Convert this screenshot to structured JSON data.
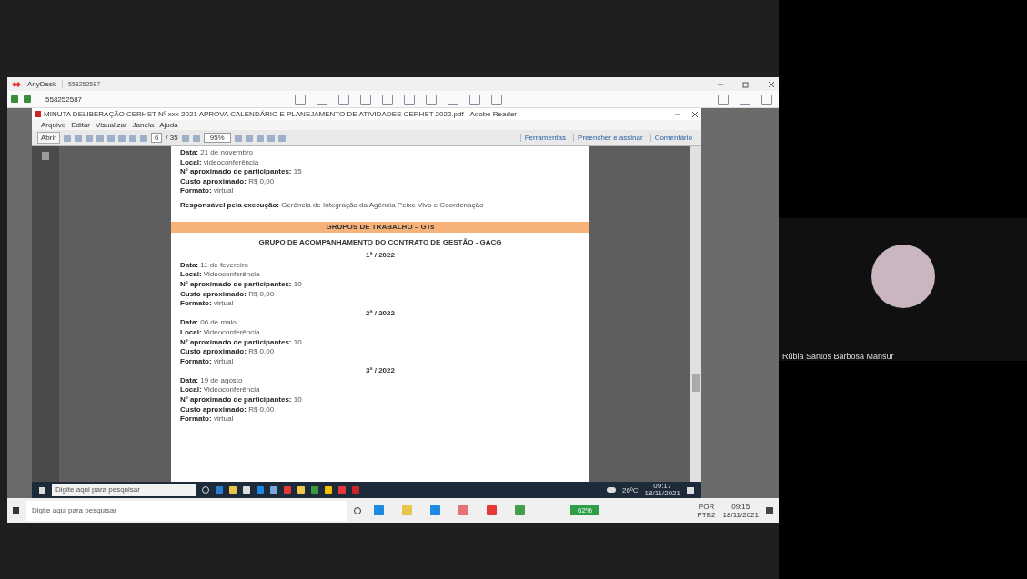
{
  "anydesk": {
    "app_name": "AnyDesk",
    "tab_label": "558252587",
    "address": "558252587"
  },
  "reader": {
    "title": "MINUTA DELIBERAÇÃO CERHST Nº xxx 2021 APROVA CALENDÁRIO E PLANEJAMENTO DE ATIVIDADES CERHST 2022.pdf - Adobe Reader",
    "menu": [
      "Arquivo",
      "Editar",
      "Visualizar",
      "Janela",
      "Ajuda"
    ],
    "open_button": "Abrir",
    "page_number": "6",
    "page_total": "/ 35",
    "zoom": "95%",
    "panel_buttons": [
      "Ferramentas",
      "Preencher e assinar",
      "Comentário"
    ]
  },
  "document": {
    "top_lines": [
      "**Data:** 21 de novembro",
      "**Local:** videoconferência",
      "**Nº aproximado de participantes:** 15",
      "**Custo aproximado:** R$ 0,00",
      "**Formato:** virtual"
    ],
    "responsible": "**Responsável pela execução:** Gerência de Integração da Agência Peixe Vivo e Coordenação",
    "section_banner": "GRUPOS DE TRABALHO – GTs",
    "group_title": "GRUPO DE ACOMPANHAMENTO DO CONTRATO DE GESTÃO - GACG",
    "meetings": [
      {
        "heading": "1ª / 2022",
        "lines": [
          "**Data:** 11 de fevereiro",
          "**Local:** Videoconferência",
          "**Nº aproximado de participantes:** 10",
          "**Custo aproximado:** R$ 0,00",
          "**Formato:** virtual"
        ]
      },
      {
        "heading": "2ª / 2022",
        "lines": [
          "**Data:** 06 de maio",
          "**Local:** Videoconferência",
          "**Nº aproximado de participantes:** 10",
          "**Custo aproximado:** R$ 0,00",
          "**Formato:** virtual"
        ]
      },
      {
        "heading": "3ª / 2022",
        "lines": [
          "**Data:** 19 de agosto",
          "**Local:** Videoconferência",
          "**Nº aproximado de participantes:** 10",
          "**Custo aproximado:** R$ 0,00",
          "**Formato:** virtual"
        ]
      }
    ]
  },
  "remote_taskbar": {
    "search_placeholder": "Digite aqui para pesquisar",
    "weather": "26ºC",
    "time": "09:17",
    "date": "18/11/2021"
  },
  "local_taskbar": {
    "search_placeholder": "Digite aqui para pesquisar",
    "battery": "62%",
    "language": "POR",
    "layout": "PTB2",
    "time": "09:15",
    "date": "18/11/2021"
  },
  "participant": {
    "name": "Rúbia Santos Barbosa Mansur"
  }
}
